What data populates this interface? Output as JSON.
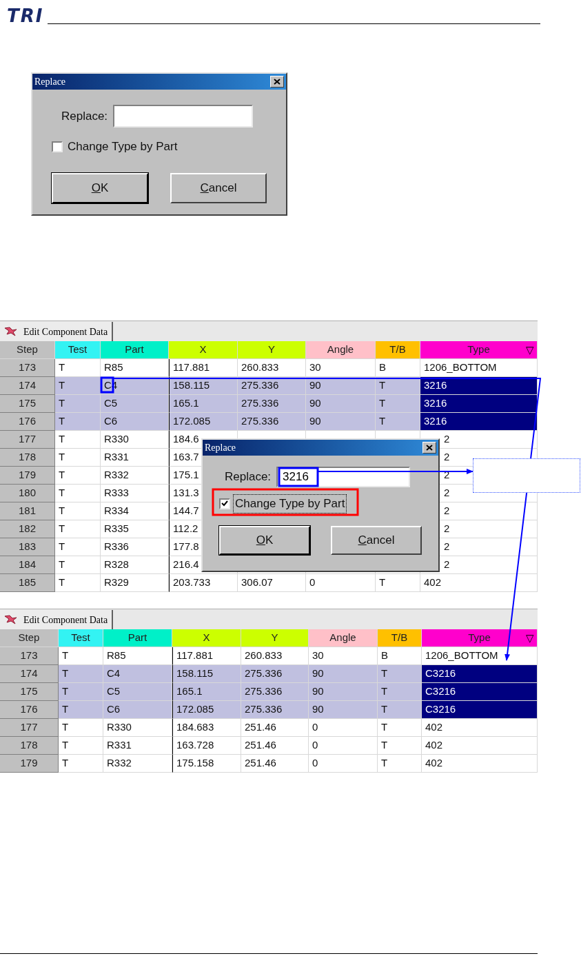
{
  "header": {
    "logo": "TRI"
  },
  "dialog": {
    "title": "Replace",
    "field_label": "Replace:",
    "checkbox_label": "Change Type by Part",
    "checked": false,
    "focused": false,
    "buttons": [
      {
        "mnemonic": "O",
        "rest": "K",
        "default": true
      },
      {
        "mnemonic": "C",
        "rest": "ancel",
        "default": false
      }
    ]
  },
  "tables": [
    {
      "tab": "Edit Component Data",
      "sort_mark": "▽",
      "columns": [
        {
          "label": "Step",
          "color": "#c0c0c0"
        },
        {
          "label": "Test",
          "color": "#33f3f3"
        },
        {
          "label": "Part",
          "color": "#00f0c8"
        },
        {
          "label": "X",
          "color": "#ccff00"
        },
        {
          "label": "Y",
          "color": "#ccff00"
        },
        {
          "label": "Angle",
          "color": "#ffc0c8"
        },
        {
          "label": "T/B",
          "color": "#ffc000"
        },
        {
          "label": "Type",
          "color": "#ff00cc"
        }
      ],
      "rows": [
        {
          "selected": false,
          "covered": false,
          "cells": [
            "173",
            "T",
            "R85",
            "117.881",
            "260.833",
            "30",
            "B",
            "1206_BOTTOM"
          ]
        },
        {
          "selected": true,
          "covered": false,
          "cells": [
            "174",
            "T",
            "C4",
            "158.115",
            "275.336",
            "90",
            "T",
            "3216"
          ]
        },
        {
          "selected": true,
          "covered": false,
          "cells": [
            "175",
            "T",
            "C5",
            "165.1",
            "275.336",
            "90",
            "T",
            "3216"
          ]
        },
        {
          "selected": true,
          "covered": false,
          "cells": [
            "176",
            "T",
            "C6",
            "172.085",
            "275.336",
            "90",
            "T",
            "3216"
          ]
        },
        {
          "selected": false,
          "covered": true,
          "cells": [
            "177",
            "T",
            "R330",
            "184.6",
            null,
            null,
            null,
            "2"
          ]
        },
        {
          "selected": false,
          "covered": true,
          "cells": [
            "178",
            "T",
            "R331",
            "163.7",
            null,
            null,
            null,
            "2"
          ]
        },
        {
          "selected": false,
          "covered": true,
          "cells": [
            "179",
            "T",
            "R332",
            "175.1",
            null,
            null,
            null,
            "2"
          ]
        },
        {
          "selected": false,
          "covered": true,
          "cells": [
            "180",
            "T",
            "R333",
            "131.3",
            null,
            null,
            null,
            "2"
          ]
        },
        {
          "selected": false,
          "covered": true,
          "cells": [
            "181",
            "T",
            "R334",
            "144.7",
            null,
            null,
            null,
            "2"
          ]
        },
        {
          "selected": false,
          "covered": true,
          "cells": [
            "182",
            "T",
            "R335",
            "112.2",
            null,
            null,
            null,
            "2"
          ]
        },
        {
          "selected": false,
          "covered": true,
          "cells": [
            "183",
            "T",
            "R336",
            "177.8",
            null,
            null,
            null,
            "2"
          ]
        },
        {
          "selected": false,
          "covered": true,
          "cells": [
            "184",
            "T",
            "R328",
            "216.4",
            null,
            null,
            null,
            "2"
          ]
        },
        {
          "selected": false,
          "covered": false,
          "cells": [
            "185",
            "T",
            "R329",
            "203.733",
            "306.07",
            "0",
            "T",
            "402"
          ]
        }
      ],
      "dialog": {
        "title": "Replace",
        "field_label": "Replace:",
        "value": "3216",
        "checkbox_label": "Change Type by Part",
        "checked": true,
        "focused": true,
        "buttons": [
          {
            "mnemonic": "O",
            "rest": "K",
            "default": true
          },
          {
            "mnemonic": "C",
            "rest": "ancel",
            "default": false
          }
        ]
      }
    },
    {
      "tab": "Edit Component Data",
      "sort_mark": "▽",
      "columns": [
        {
          "label": "Step",
          "color": "#c0c0c0"
        },
        {
          "label": "Test",
          "color": "#33f3f3"
        },
        {
          "label": "Part",
          "color": "#00f0c8"
        },
        {
          "label": "X",
          "color": "#ccff00"
        },
        {
          "label": "Y",
          "color": "#ccff00"
        },
        {
          "label": "Angle",
          "color": "#ffc0c8"
        },
        {
          "label": "T/B",
          "color": "#ffc000"
        },
        {
          "label": "Type",
          "color": "#ff00cc"
        }
      ],
      "rows": [
        {
          "selected": false,
          "covered": false,
          "cells": [
            "173",
            "T",
            "R85",
            "117.881",
            "260.833",
            "30",
            "B",
            "1206_BOTTOM"
          ]
        },
        {
          "selected": true,
          "covered": false,
          "cells": [
            "174",
            "T",
            "C4",
            "158.115",
            "275.336",
            "90",
            "T",
            "C3216"
          ]
        },
        {
          "selected": true,
          "covered": false,
          "cells": [
            "175",
            "T",
            "C5",
            "165.1",
            "275.336",
            "90",
            "T",
            "C3216"
          ]
        },
        {
          "selected": true,
          "covered": false,
          "cells": [
            "176",
            "T",
            "C6",
            "172.085",
            "275.336",
            "90",
            "T",
            "C3216"
          ]
        },
        {
          "selected": false,
          "covered": false,
          "cells": [
            "177",
            "T",
            "R330",
            "184.683",
            "251.46",
            "0",
            "T",
            "402"
          ]
        },
        {
          "selected": false,
          "covered": false,
          "cells": [
            "178",
            "T",
            "R331",
            "163.728",
            "251.46",
            "0",
            "T",
            "402"
          ]
        },
        {
          "selected": false,
          "covered": false,
          "cells": [
            "179",
            "T",
            "R332",
            "175.158",
            "251.46",
            "0",
            "T",
            "402"
          ]
        }
      ]
    }
  ]
}
